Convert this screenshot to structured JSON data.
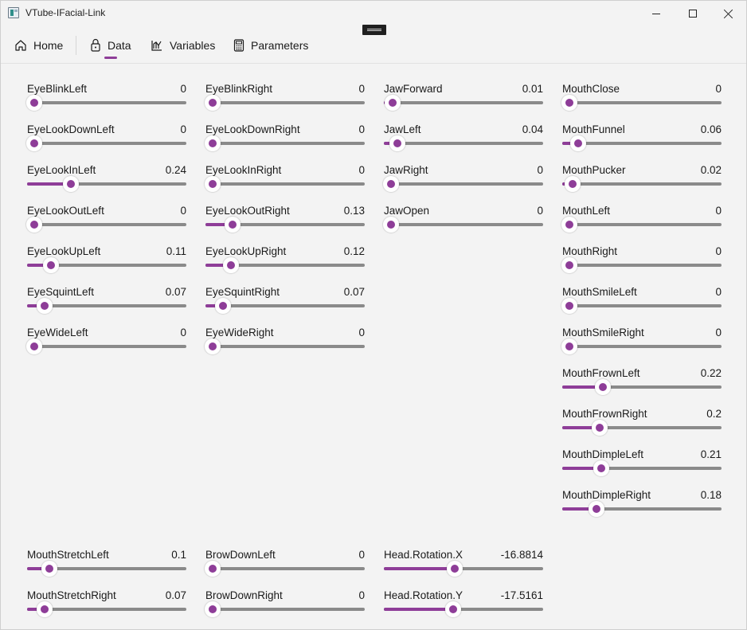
{
  "window": {
    "title": "VTube-IFacial-Link"
  },
  "nav": {
    "home": "Home",
    "data": "Data",
    "variables": "Variables",
    "parameters": "Parameters"
  },
  "sliders": [
    {
      "label": "EyeBlinkLeft",
      "value": "0",
      "fraction": 0
    },
    {
      "label": "EyeLookDownLeft",
      "value": "0",
      "fraction": 0
    },
    {
      "label": "EyeLookInLeft",
      "value": "0.24",
      "fraction": 0.24
    },
    {
      "label": "EyeLookOutLeft",
      "value": "0",
      "fraction": 0
    },
    {
      "label": "EyeLookUpLeft",
      "value": "0.11",
      "fraction": 0.11
    },
    {
      "label": "EyeSquintLeft",
      "value": "0.07",
      "fraction": 0.07
    },
    {
      "label": "EyeWideLeft",
      "value": "0",
      "fraction": 0
    },
    {
      "label": "EyeBlinkRight",
      "value": "0",
      "fraction": 0
    },
    {
      "label": "EyeLookDownRight",
      "value": "0",
      "fraction": 0
    },
    {
      "label": "EyeLookInRight",
      "value": "0",
      "fraction": 0
    },
    {
      "label": "EyeLookOutRight",
      "value": "0.13",
      "fraction": 0.13
    },
    {
      "label": "EyeLookUpRight",
      "value": "0.12",
      "fraction": 0.12
    },
    {
      "label": "EyeSquintRight",
      "value": "0.07",
      "fraction": 0.07
    },
    {
      "label": "EyeWideRight",
      "value": "0",
      "fraction": 0
    },
    {
      "label": "JawForward",
      "value": "0.01",
      "fraction": 0.01
    },
    {
      "label": "JawLeft",
      "value": "0.04",
      "fraction": 0.04
    },
    {
      "label": "JawRight",
      "value": "0",
      "fraction": 0
    },
    {
      "label": "JawOpen",
      "value": "0",
      "fraction": 0
    },
    {
      "label": "MouthClose",
      "value": "0",
      "fraction": 0
    },
    {
      "label": "MouthFunnel",
      "value": "0.06",
      "fraction": 0.06
    },
    {
      "label": "MouthPucker",
      "value": "0.02",
      "fraction": 0.02
    },
    {
      "label": "MouthLeft",
      "value": "0",
      "fraction": 0
    },
    {
      "label": "MouthRight",
      "value": "0",
      "fraction": 0
    },
    {
      "label": "MouthSmileLeft",
      "value": "0",
      "fraction": 0
    },
    {
      "label": "MouthSmileRight",
      "value": "0",
      "fraction": 0
    },
    {
      "label": "MouthFrownLeft",
      "value": "0.22",
      "fraction": 0.22
    },
    {
      "label": "MouthFrownRight",
      "value": "0.2",
      "fraction": 0.2
    },
    {
      "label": "MouthDimpleLeft",
      "value": "0.21",
      "fraction": 0.21
    },
    {
      "label": "MouthDimpleRight",
      "value": "0.18",
      "fraction": 0.18
    },
    {
      "label": "MouthStretchLeft",
      "value": "0.1",
      "fraction": 0.1
    },
    {
      "label": "MouthStretchRight",
      "value": "0.07",
      "fraction": 0.07
    },
    {
      "label": "BrowDownLeft",
      "value": "0",
      "fraction": 0
    },
    {
      "label": "BrowDownRight",
      "value": "0",
      "fraction": 0
    },
    {
      "label": "Head.Rotation.X",
      "value": "-16.8814",
      "fraction": 0.42
    },
    {
      "label": "Head.Rotation.Y",
      "value": "-17.5161",
      "fraction": 0.41
    }
  ]
}
